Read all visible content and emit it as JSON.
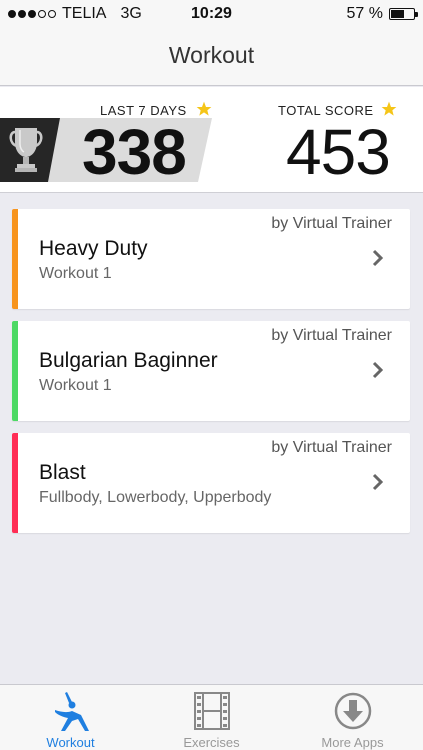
{
  "status_bar": {
    "carrier": "TELIA",
    "network": "3G",
    "time": "10:29",
    "battery": "57 %",
    "battery_level": 0.57,
    "signal_bars_on": 3,
    "signal_bars_total": 5
  },
  "nav": {
    "title": "Workout"
  },
  "scores": {
    "last7_label": "LAST 7 DAYS",
    "last7_value": "338",
    "total_label": "TOTAL SCORE",
    "total_value": "453",
    "star_color": "#f5c518"
  },
  "workouts": [
    {
      "author": "by Virtual Trainer",
      "title": "Heavy Duty",
      "subtitle": "Workout 1",
      "accent": "#f7941d"
    },
    {
      "author": "by Virtual Trainer",
      "title": "Bulgarian Baginner",
      "subtitle": "Workout 1",
      "accent": "#4cd964"
    },
    {
      "author": "by Virtual Trainer",
      "title": "Blast",
      "subtitle": "Fullbody, Lowerbody, Upperbody",
      "accent": "#ff2d55"
    }
  ],
  "tabs": [
    {
      "label": "Workout",
      "icon": "workout-figure-icon",
      "active": true
    },
    {
      "label": "Exercises",
      "icon": "film-strip-icon",
      "active": false
    },
    {
      "label": "More Apps",
      "icon": "download-circle-icon",
      "active": false
    }
  ],
  "colors": {
    "accent_blue": "#1f7fe0"
  }
}
